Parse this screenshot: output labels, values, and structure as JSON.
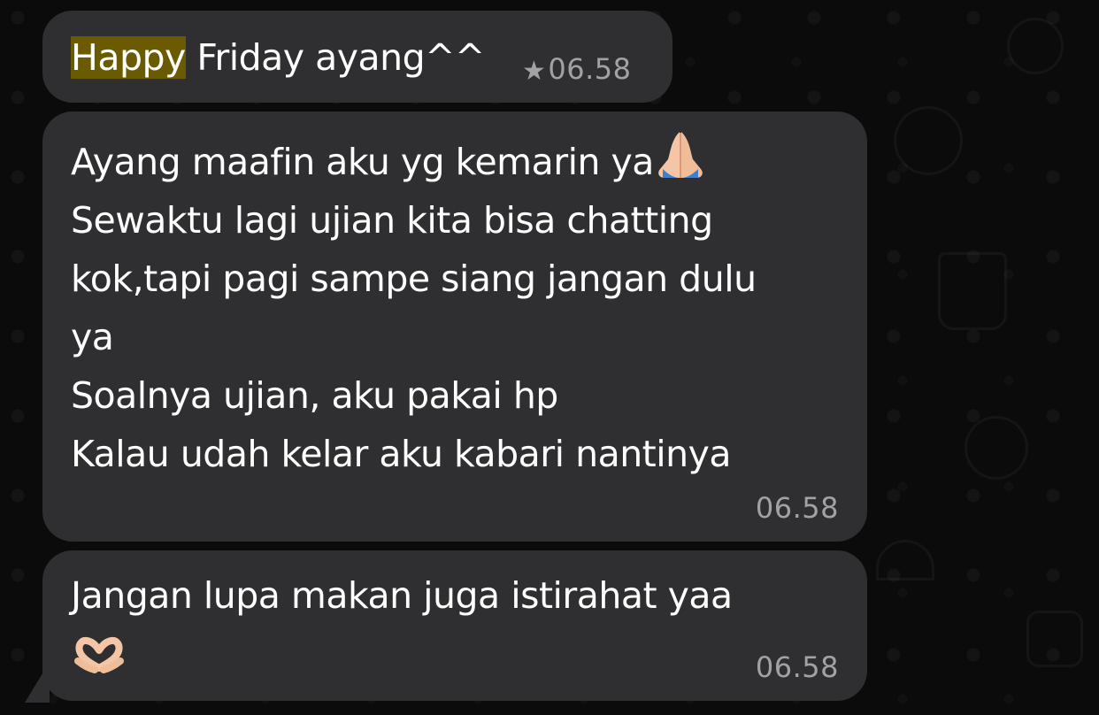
{
  "messages": [
    {
      "highlighted": "Happy",
      "rest": " Friday ayang^^",
      "time": "06.58"
    },
    {
      "lines": [
        "Ayang maafin aku yg kemarin ya",
        "Sewaktu lagi ujian kita bisa chatting",
        "kok,tapi pagi sampe siang jangan dulu",
        "ya",
        "Soalnya ujian, aku pakai hp",
        "Kalau udah kelar aku kabari nantinya"
      ],
      "time": "06.58"
    },
    {
      "lines": [
        "Jangan lupa makan juga istirahat yaa"
      ],
      "time": "06.58"
    }
  ],
  "icons": {
    "starred": "star-icon",
    "prayer": "praying-hands-icon",
    "heart": "heart-hands-icon"
  },
  "colors": {
    "bubble": "#2f2f31",
    "background": "#0b0b0b",
    "highlight": "#6b5b00",
    "timestamp": "#a2a2a6"
  }
}
